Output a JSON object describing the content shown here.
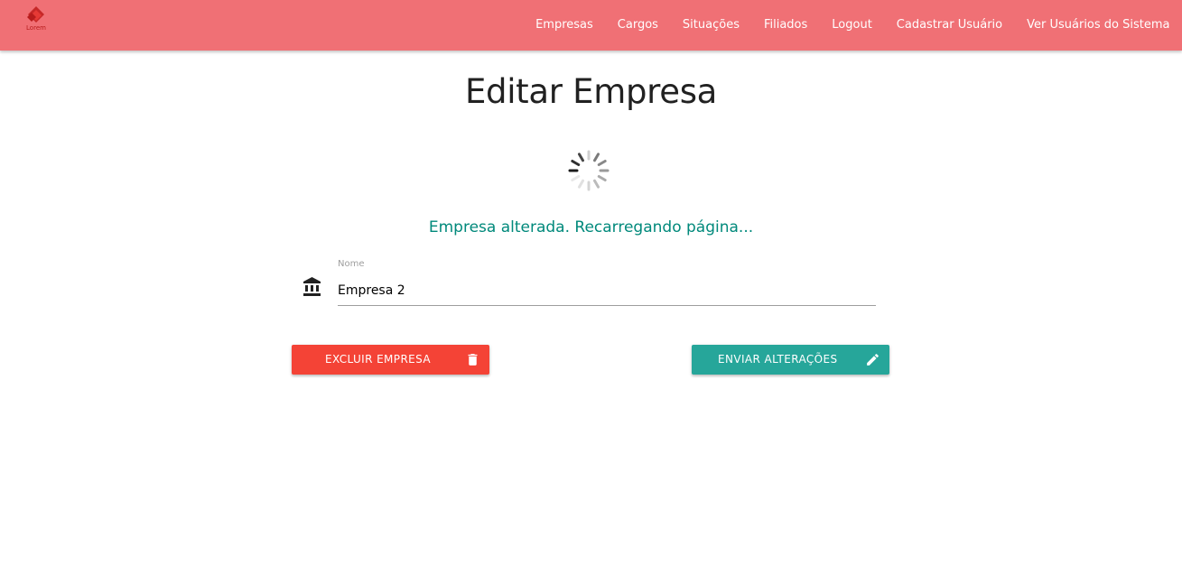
{
  "navbar": {
    "logo_text": "Lorem",
    "links": [
      "Empresas",
      "Cargos",
      "Situações",
      "Filiados",
      "Logout",
      "Cadastrar Usuário",
      "Ver Usuários do Sistema"
    ],
    "background": "#f07075"
  },
  "page": {
    "title": "Editar Empresa",
    "status_message": "Empresa alterada. Recarregando página...",
    "status_color": "#00897b"
  },
  "form": {
    "nome_label": "Nome",
    "nome_value": "Empresa 2",
    "field_icon": "account-balance-icon"
  },
  "buttons": {
    "delete_label": "EXCLUIR EMPRESA",
    "delete_color": "#f44336",
    "delete_icon": "trash-icon",
    "submit_label": "ENVIAR ALTERAÇÕES",
    "submit_color": "#26a69a",
    "submit_icon": "pencil-icon"
  }
}
